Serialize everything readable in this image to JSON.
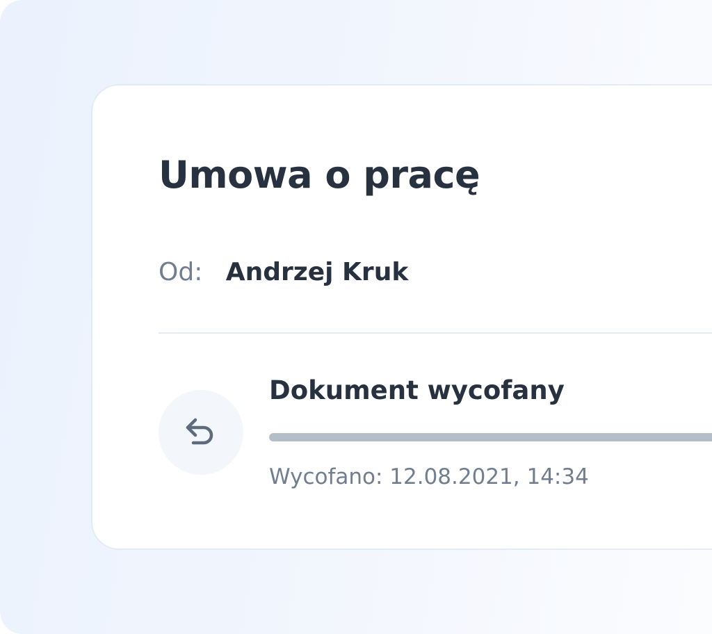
{
  "document": {
    "title": "Umowa o pracę",
    "from_label": "Od:",
    "from_name": "Andrzej Kruk"
  },
  "status": {
    "icon": "undo-arrow-icon",
    "title": "Dokument wycofany",
    "progress": 1.0,
    "timestamp": "Wycofano: 12.08.2021, 14:34"
  },
  "colors": {
    "text_primary": "#27313f",
    "text_secondary": "#707e8f",
    "progress_fill": "#b4bec9"
  }
}
